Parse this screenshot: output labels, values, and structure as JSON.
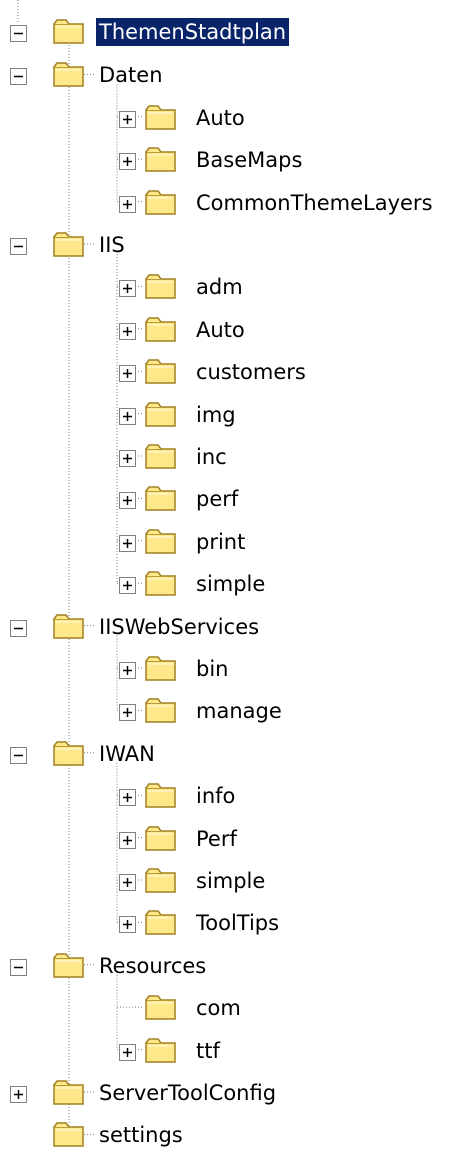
{
  "tree": {
    "root": {
      "label": "ThemenStadtplan",
      "expanded": true,
      "selected": true
    },
    "items": [
      {
        "label": "Daten",
        "level": 1,
        "toggle": "minus"
      },
      {
        "label": "Auto",
        "level": 2,
        "toggle": "plus"
      },
      {
        "label": "BaseMaps",
        "level": 2,
        "toggle": "plus"
      },
      {
        "label": "CommonThemeLayers",
        "level": 2,
        "toggle": "plus"
      },
      {
        "label": "IIS",
        "level": 1,
        "toggle": "minus"
      },
      {
        "label": "adm",
        "level": 2,
        "toggle": "plus"
      },
      {
        "label": "Auto",
        "level": 2,
        "toggle": "plus"
      },
      {
        "label": "customers",
        "level": 2,
        "toggle": "plus"
      },
      {
        "label": "img",
        "level": 2,
        "toggle": "plus"
      },
      {
        "label": "inc",
        "level": 2,
        "toggle": "plus"
      },
      {
        "label": "perf",
        "level": 2,
        "toggle": "plus"
      },
      {
        "label": "print",
        "level": 2,
        "toggle": "plus"
      },
      {
        "label": "simple",
        "level": 2,
        "toggle": "plus"
      },
      {
        "label": "IISWebServices",
        "level": 1,
        "toggle": "minus"
      },
      {
        "label": "bin",
        "level": 2,
        "toggle": "plus"
      },
      {
        "label": "manage",
        "level": 2,
        "toggle": "plus"
      },
      {
        "label": "IWAN",
        "level": 1,
        "toggle": "minus"
      },
      {
        "label": "info",
        "level": 2,
        "toggle": "plus"
      },
      {
        "label": "Perf",
        "level": 2,
        "toggle": "plus"
      },
      {
        "label": "simple",
        "level": 2,
        "toggle": "plus"
      },
      {
        "label": "ToolTips",
        "level": 2,
        "toggle": "plus"
      },
      {
        "label": "Resources",
        "level": 1,
        "toggle": "minus"
      },
      {
        "label": "com",
        "level": 2,
        "toggle": "none"
      },
      {
        "label": "ttf",
        "level": 2,
        "toggle": "plus"
      },
      {
        "label": "ServerToolConfig",
        "level": 1,
        "toggle": "plus"
      },
      {
        "label": "settings",
        "level": 1,
        "toggle": "none"
      }
    ]
  },
  "icons": {
    "folder": "folder-icon",
    "expand": "plus-toggle-icon",
    "collapse": "minus-toggle-icon"
  },
  "colors": {
    "selection": "#0a246a",
    "folder_fill": "#ffe88a",
    "folder_edge": "#a08020",
    "lines": "#808080"
  }
}
